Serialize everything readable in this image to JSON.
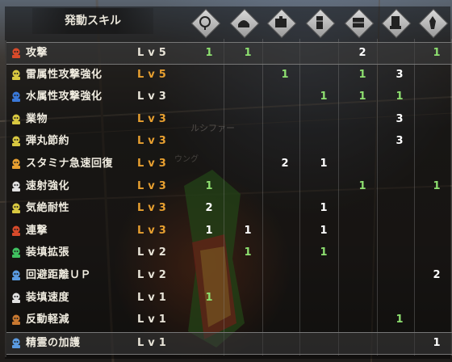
{
  "header": {
    "title": "発動スキル"
  },
  "column_icons": [
    "charm-slot-icon",
    "helmet-icon",
    "chest-armor-icon",
    "gauntlet-icon",
    "waist-armor-icon",
    "leg-armor-icon",
    "talisman-icon"
  ],
  "background_labels": {
    "name1": "ルシファー",
    "name2": "ウング"
  },
  "skills": [
    {
      "name": "攻撃",
      "level": "Lv5",
      "icon_color": "#d84a2a",
      "lv_color": "white",
      "values": [
        "1",
        "1",
        "",
        "",
        "2",
        "",
        "1"
      ],
      "colors": [
        "green",
        "green",
        "",
        "",
        "white",
        "",
        "green"
      ],
      "highlight": true
    },
    {
      "name": "雷属性攻撃強化",
      "level": "Lv5",
      "icon_color": "#d8c840",
      "lv_color": "orange",
      "values": [
        "",
        "",
        "1",
        "",
        "1",
        "3",
        ""
      ],
      "colors": [
        "",
        "",
        "green",
        "",
        "green",
        "white",
        ""
      ]
    },
    {
      "name": "水属性攻撃強化",
      "level": "Lv3",
      "icon_color": "#3a78d8",
      "lv_color": "white",
      "values": [
        "",
        "",
        "",
        "1",
        "1",
        "1",
        ""
      ],
      "colors": [
        "",
        "",
        "",
        "green",
        "green",
        "green",
        ""
      ]
    },
    {
      "name": "業物",
      "level": "Lv3",
      "icon_color": "#d8c840",
      "lv_color": "orange",
      "values": [
        "",
        "",
        "",
        "",
        "",
        "3",
        ""
      ],
      "colors": [
        "",
        "",
        "",
        "",
        "",
        "white",
        ""
      ]
    },
    {
      "name": "弾丸節約",
      "level": "Lv3",
      "icon_color": "#d8c840",
      "lv_color": "orange",
      "values": [
        "",
        "",
        "",
        "",
        "",
        "3",
        ""
      ],
      "colors": [
        "",
        "",
        "",
        "",
        "",
        "white",
        ""
      ]
    },
    {
      "name": "スタミナ急速回復",
      "level": "Lv3",
      "icon_color": "#e8a030",
      "lv_color": "orange",
      "values": [
        "",
        "",
        "2",
        "1",
        "",
        "",
        ""
      ],
      "colors": [
        "",
        "",
        "white",
        "white",
        "",
        "",
        ""
      ]
    },
    {
      "name": "速射強化",
      "level": "Lv3",
      "icon_color": "#e0e0e0",
      "lv_color": "orange",
      "values": [
        "1",
        "",
        "",
        "",
        "1",
        "",
        "1"
      ],
      "colors": [
        "green",
        "",
        "",
        "",
        "green",
        "",
        "green"
      ]
    },
    {
      "name": "気絶耐性",
      "level": "Lv3",
      "icon_color": "#d8c840",
      "lv_color": "orange",
      "values": [
        "2",
        "",
        "",
        "1",
        "",
        "",
        ""
      ],
      "colors": [
        "white",
        "",
        "",
        "white",
        "",
        "",
        ""
      ]
    },
    {
      "name": "連撃",
      "level": "Lv3",
      "icon_color": "#d84a2a",
      "lv_color": "orange",
      "values": [
        "1",
        "1",
        "",
        "1",
        "",
        "",
        ""
      ],
      "colors": [
        "white",
        "white",
        "",
        "white",
        "",
        "",
        ""
      ]
    },
    {
      "name": "装填拡張",
      "level": "Lv2",
      "icon_color": "#40c060",
      "lv_color": "white",
      "values": [
        "",
        "1",
        "",
        "1",
        "",
        "",
        ""
      ],
      "colors": [
        "",
        "green",
        "",
        "green",
        "",
        "",
        ""
      ]
    },
    {
      "name": "回避距離ＵＰ",
      "level": "Lv2",
      "icon_color": "#5a9ae0",
      "lv_color": "white",
      "values": [
        "",
        "",
        "",
        "",
        "",
        "",
        "2"
      ],
      "colors": [
        "",
        "",
        "",
        "",
        "",
        "",
        "white"
      ]
    },
    {
      "name": "装填速度",
      "level": "Lv1",
      "icon_color": "#e0e0e0",
      "lv_color": "white",
      "values": [
        "1",
        "",
        "",
        "",
        "",
        "",
        ""
      ],
      "colors": [
        "green",
        "",
        "",
        "",
        "",
        "",
        ""
      ]
    },
    {
      "name": "反動軽減",
      "level": "Lv1",
      "icon_color": "#c87830",
      "lv_color": "white",
      "values": [
        "",
        "",
        "",
        "",
        "",
        "1",
        ""
      ],
      "colors": [
        "",
        "",
        "",
        "",
        "",
        "green",
        ""
      ]
    },
    {
      "name": "精霊の加護",
      "level": "Lv1",
      "icon_color": "#5a9ae0",
      "lv_color": "white",
      "values": [
        "",
        "",
        "",
        "",
        "",
        "",
        "1"
      ],
      "colors": [
        "",
        "",
        "",
        "",
        "",
        "",
        "white"
      ],
      "highlight": true
    }
  ]
}
